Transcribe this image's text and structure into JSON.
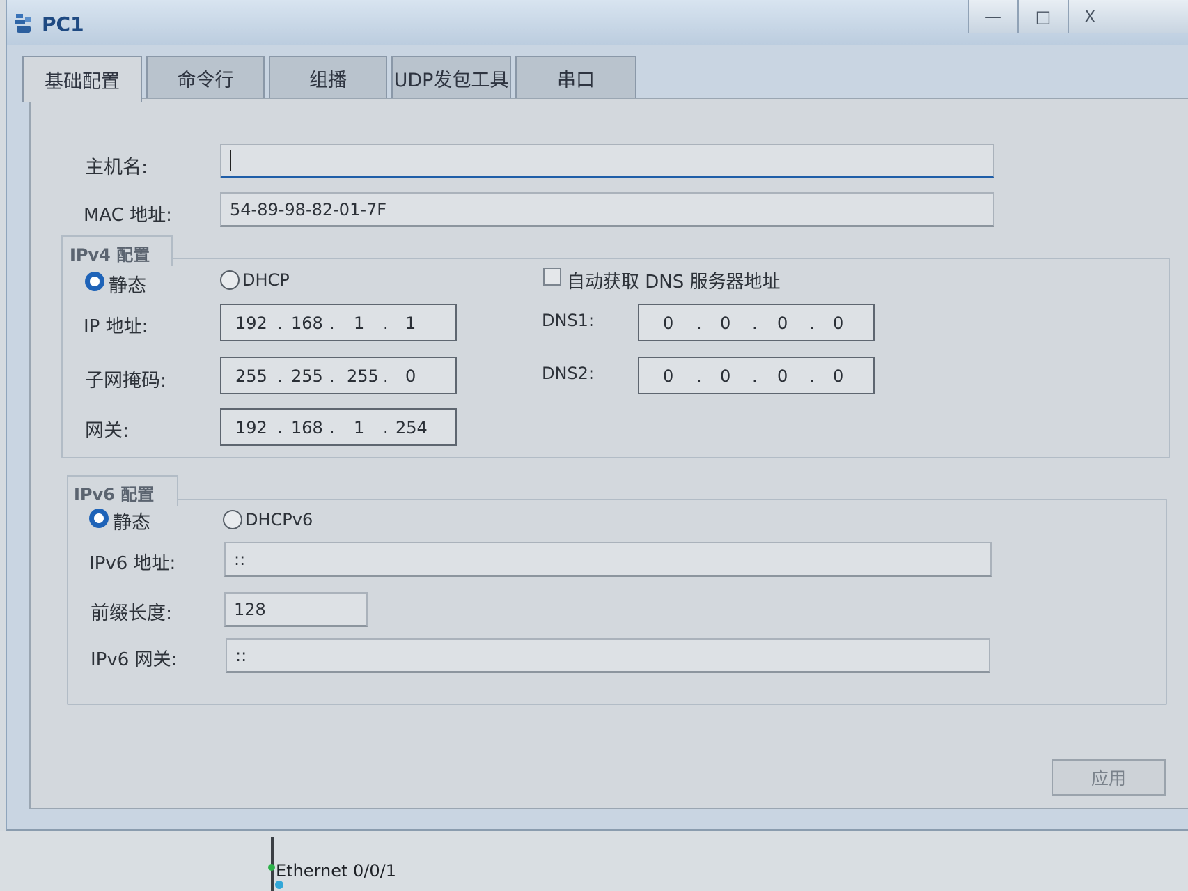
{
  "window": {
    "title": "PC1",
    "minimize_label": "—",
    "maximize_label": "□",
    "close_label": "X"
  },
  "tabs": [
    {
      "label": "基础配置"
    },
    {
      "label": "命令行"
    },
    {
      "label": "组播"
    },
    {
      "label": "UDP发包工具"
    },
    {
      "label": "串口"
    }
  ],
  "basic": {
    "hostname_label": "主机名:",
    "hostname_value": "",
    "mac_label": "MAC 地址:",
    "mac_value": "54-89-98-82-01-7F"
  },
  "ipv4": {
    "group_title": "IPv4 配置",
    "static_label": "静态",
    "dhcp_label": "DHCP",
    "auto_dns_label": "自动获取 DNS 服务器地址",
    "ip_label": "IP 地址:",
    "ip": [
      "192",
      "168",
      "1",
      "1"
    ],
    "mask_label": "子网掩码:",
    "mask": [
      "255",
      "255",
      "255",
      "0"
    ],
    "gateway_label": "网关:",
    "gateway": [
      "192",
      "168",
      "1",
      "254"
    ],
    "dns1_label": "DNS1:",
    "dns1": [
      "0",
      "0",
      "0",
      "0"
    ],
    "dns2_label": "DNS2:",
    "dns2": [
      "0",
      "0",
      "0",
      "0"
    ],
    "mode": "static",
    "auto_dns_checked": false
  },
  "ipv6": {
    "group_title": "IPv6 配置",
    "static_label": "静态",
    "dhcpv6_label": "DHCPv6",
    "address_label": "IPv6 地址:",
    "address_value": "::",
    "prefix_label": "前缀长度:",
    "prefix_value": "128",
    "gateway_label": "IPv6 网关:",
    "gateway_value": "::",
    "mode": "static"
  },
  "apply_label": "应用",
  "topology": {
    "port_label": "Ethernet 0/0/1"
  },
  "colors": {
    "accent": "#1e63b8",
    "title_text": "#1f4a82",
    "link_green": "#2db24a"
  }
}
